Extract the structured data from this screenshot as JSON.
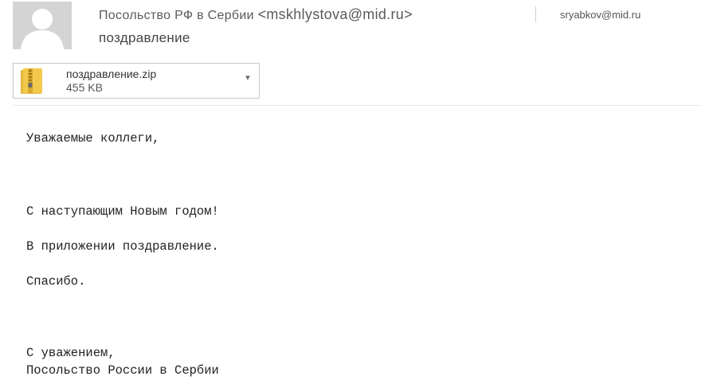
{
  "header": {
    "sender_name": "Посольство РФ в Сербии",
    "sender_email": "<mskhlystova@mid.ru>",
    "recipient": "sryabkov@mid.ru",
    "subject": "поздравление"
  },
  "attachment": {
    "icon": "zip-folder-icon",
    "filename": "поздравление.zip",
    "size": "455 KB",
    "dropdown_glyph": "▾"
  },
  "message": {
    "greeting": "Уважаемые коллеги,",
    "line1": "С наступающим Новым годом!",
    "line2": "В приложении поздравление.",
    "line3": "Спасибо.",
    "closing": "С уважением,",
    "signature": "Посольство России в Сербии"
  },
  "colors": {
    "avatar_bg": "#d4d4d4",
    "avatar_figure": "#ffffff",
    "border": "#c6c6c6",
    "zip_yellow": "#f2c94c"
  }
}
